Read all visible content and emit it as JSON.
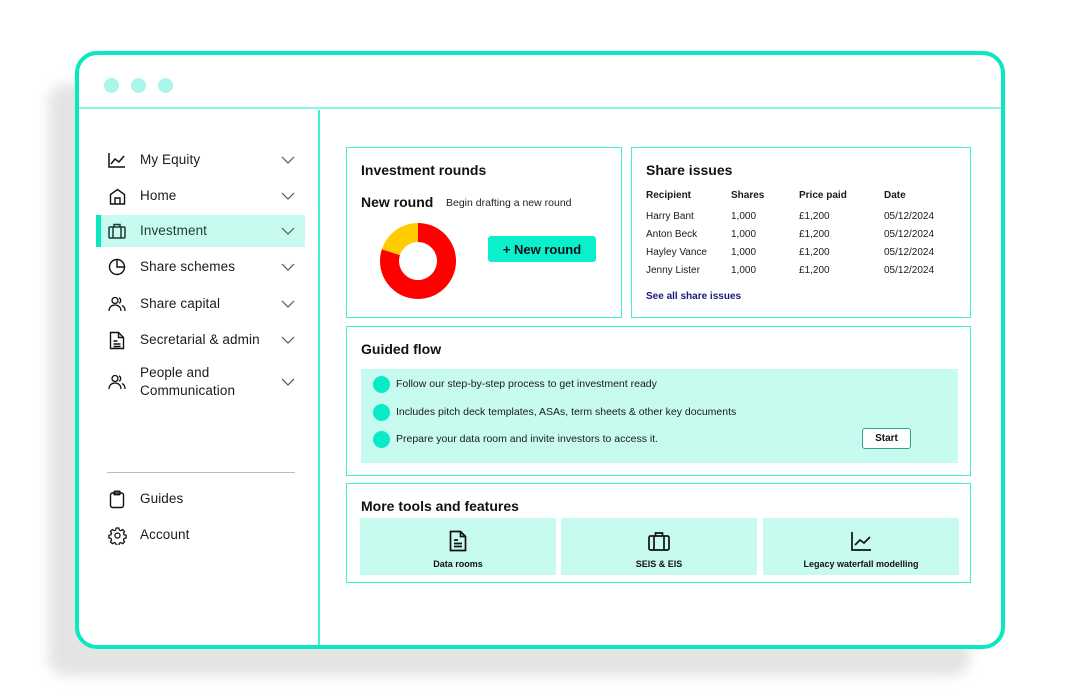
{
  "window": {
    "controls": [
      "window-dot",
      "window-dot",
      "window-dot"
    ],
    "accent_color": "#0ae8c2"
  },
  "sidebar": {
    "items": [
      {
        "label": "My Equity",
        "icon": "line-chart-icon",
        "active": false,
        "expandable": true
      },
      {
        "label": "Home",
        "icon": "home-icon",
        "active": false,
        "expandable": true
      },
      {
        "label": "Investment",
        "icon": "briefcase-icon",
        "active": true,
        "expandable": true
      },
      {
        "label": "Share schemes",
        "icon": "pie-chart-icon",
        "active": false,
        "expandable": true
      },
      {
        "label": "Share capital",
        "icon": "users-icon",
        "active": false,
        "expandable": true
      },
      {
        "label": "Secretarial & admin",
        "icon": "document-icon",
        "active": false,
        "expandable": true
      },
      {
        "label": "People and Communication",
        "label_line1": "People and",
        "label_line2": "Communication",
        "icon": "users-icon",
        "active": false,
        "expandable": true
      }
    ],
    "footer_items": [
      {
        "label": "Guides",
        "icon": "clipboard-icon"
      },
      {
        "label": "Account",
        "icon": "gear-icon"
      }
    ]
  },
  "investment_rounds": {
    "title": "Investment rounds",
    "new_round_title": "New round",
    "new_round_subtitle": "Begin drafting a new round",
    "button_label": "+ New round",
    "donut": {
      "segments": [
        {
          "name": "red-segment",
          "fraction": 0.8,
          "color": "#ff0000"
        },
        {
          "name": "yellow-segment",
          "fraction": 0.2,
          "color": "#ffcc00"
        }
      ]
    }
  },
  "share_issues": {
    "title": "Share issues",
    "columns": [
      "Recipient",
      "Shares",
      "Price paid",
      "Date"
    ],
    "rows": [
      [
        "Harry Bant",
        "1,000",
        "£1,200",
        "05/12/2024"
      ],
      [
        "Anton Beck",
        "1,000",
        "£1,200",
        "05/12/2024"
      ],
      [
        "Hayley Vance",
        "1,000",
        "£1,200",
        "05/12/2024"
      ],
      [
        "Jenny Lister",
        "1,000",
        "£1,200",
        "05/12/2024"
      ]
    ],
    "link_label": "See all share issues"
  },
  "guided_flow": {
    "title": "Guided flow",
    "steps": [
      "Follow our step-by-step process to get investment ready",
      "Includes pitch deck templates, ASAs, term sheets & other key documents",
      "Prepare your data room and invite investors to access it."
    ],
    "button_label": "Start"
  },
  "tools": {
    "title": "More tools and features",
    "tiles": [
      {
        "label": "Data rooms",
        "icon": "document-icon"
      },
      {
        "label": "SEIS & EIS",
        "icon": "briefcase-icon"
      },
      {
        "label": "Legacy waterfall modelling",
        "icon": "line-chart-icon"
      }
    ]
  }
}
